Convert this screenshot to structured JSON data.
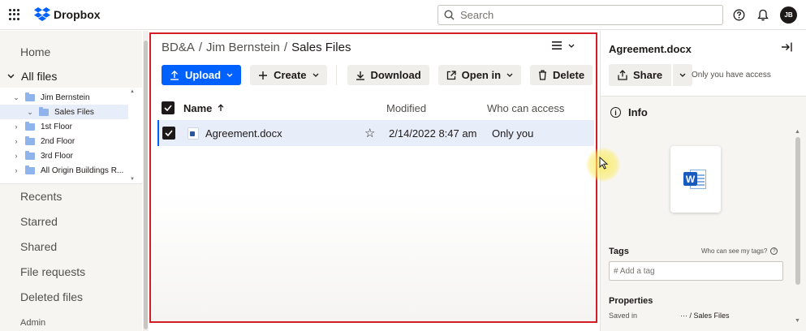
{
  "app": {
    "name": "Dropbox"
  },
  "topbar": {
    "search_placeholder": "Search",
    "avatar_initials": "JB",
    "icons": [
      "app-grid-icon",
      "search-icon",
      "help-icon",
      "bell-icon"
    ]
  },
  "sidebar": {
    "home": "Home",
    "all_files": "All files",
    "tree": [
      {
        "label": "Jim Bernstein",
        "expanded": true
      },
      {
        "label": "Sales Files",
        "expanded": true,
        "selected": true
      },
      {
        "label": "1st Floor"
      },
      {
        "label": "2nd Floor"
      },
      {
        "label": "3rd Floor"
      },
      {
        "label": "All Origin Buildings R..."
      }
    ],
    "nav": [
      "Recents",
      "Starred",
      "Shared",
      "File requests",
      "Deleted files",
      "Admin"
    ]
  },
  "main": {
    "breadcrumb": [
      "BD&A",
      "Jim Bernstein",
      "Sales Files"
    ],
    "toolbar": {
      "upload": "Upload",
      "create": "Create",
      "download": "Download",
      "open_in": "Open in",
      "delete": "Delete"
    },
    "columns": {
      "name": "Name",
      "modified": "Modified",
      "access": "Who can access"
    },
    "files": [
      {
        "name": "Agreement.docx",
        "modified": "2/14/2022 8:47 am",
        "access": "Only you",
        "selected": true
      }
    ]
  },
  "details": {
    "title": "Agreement.docx",
    "share": "Share",
    "access_note": "Only you have access",
    "info": "Info",
    "preview_letter": "W",
    "tags_label": "Tags",
    "tags_help": "Who can see my tags?",
    "tag_placeholder": "# Add a tag",
    "properties_label": "Properties",
    "saved_in_label": "Saved in",
    "saved_in_value": "··· / Sales Files"
  },
  "colors": {
    "accent": "#0061fe",
    "highlight_frame": "#d11d23",
    "selected_row": "#e8eef9"
  }
}
